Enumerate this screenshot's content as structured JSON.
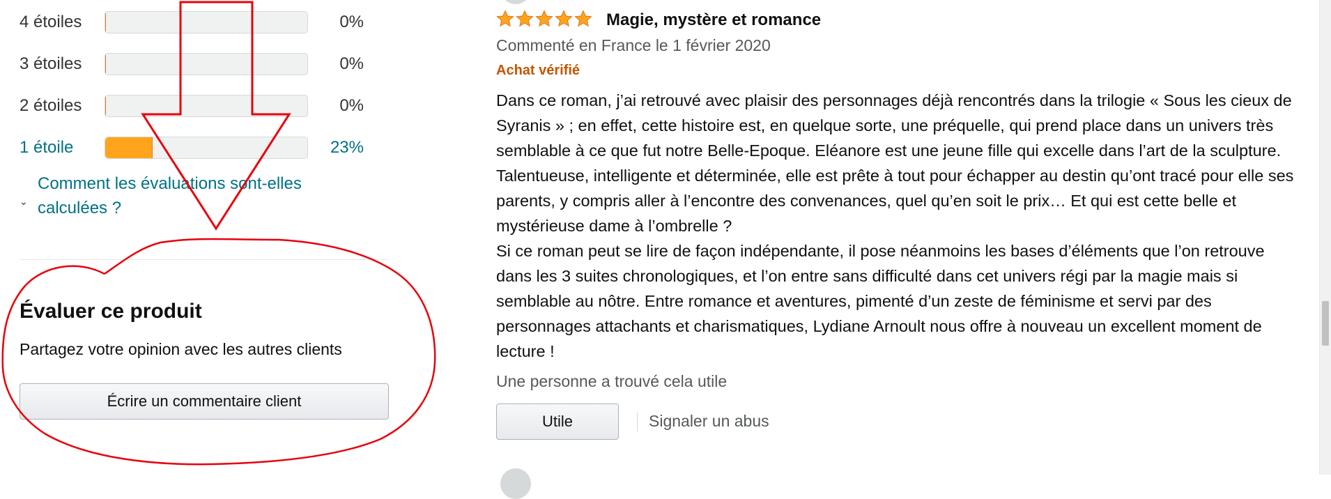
{
  "rating_histogram": {
    "rows": [
      {
        "label": "4 étoiles",
        "percent_text": "0%",
        "fill_fraction": 0.0,
        "is_link": false
      },
      {
        "label": "3 étoiles",
        "percent_text": "0%",
        "fill_fraction": 0.0,
        "is_link": false
      },
      {
        "label": "2 étoiles",
        "percent_text": "0%",
        "fill_fraction": 0.0,
        "is_link": false
      },
      {
        "label": "1 étoile",
        "percent_text": "23%",
        "fill_fraction": 0.23,
        "is_link": true
      }
    ],
    "how_calculated_link": "Comment les évaluations sont-elles calculées ?"
  },
  "review_this_product": {
    "title": "Évaluer ce produit",
    "subtitle": "Partagez votre opinion avec les autres clients",
    "button": "Écrire un commentaire client"
  },
  "review": {
    "stars": 5,
    "title": "Magie, mystère et romance",
    "date_line": "Commenté en France le 1 février 2020",
    "verified_badge": "Achat vérifié",
    "body_paragraph_1": "Dans ce roman, j’ai retrouvé avec plaisir des personnages déjà rencontrés dans la trilogie « Sous les cieux de Syranis » ; en effet, cette histoire est, en quelque sorte, une préquelle, qui prend place dans un univers très semblable à ce que fut notre Belle-Epoque. Eléanore est une jeune fille qui excelle dans l’art de la sculpture. Talentueuse, intelligente et déterminée, elle est prête à tout pour échapper au destin qu’ont tracé pour elle ses parents, y compris aller à l’encontre des convenances, quel qu’en soit le prix… Et qui est cette belle et mystérieuse dame à l’ombrelle ?",
    "body_paragraph_2": "Si ce roman peut se lire de façon indépendante, il pose néanmoins les bases d’éléments que l’on retrouve dans les 3 suites chronologiques, et l’on entre sans difficulté dans cet univers régi par la magie mais si semblable au nôtre. Entre romance et aventures, pimenté d’un zeste de féminisme et servi par des personnages attachants et charismatiques, Lydiane Arnoult nous offre à nouveau un excellent moment de lecture !",
    "helpful_text": "Une personne a trouvé cela utile",
    "useful_button": "Utile",
    "report_link": "Signaler un abus"
  },
  "colors": {
    "star": "#ffa41c",
    "star_border": "#de7921",
    "link": "#007185",
    "verified": "#c45500",
    "annotation_red": "#e8000b"
  }
}
